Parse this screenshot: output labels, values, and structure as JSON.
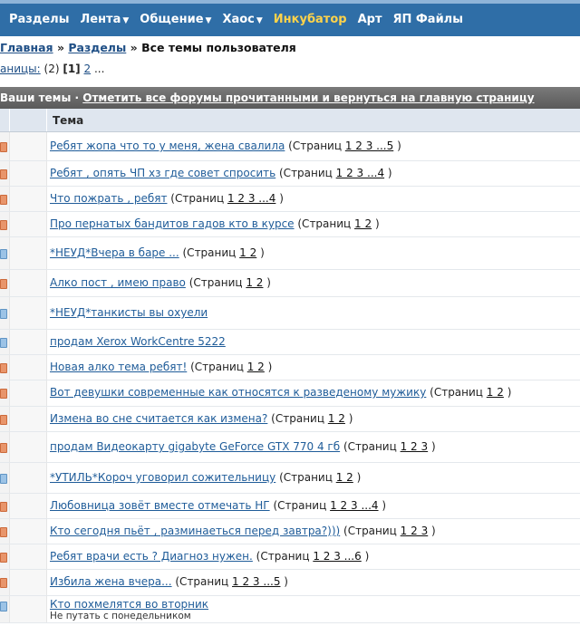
{
  "nav": [
    {
      "label": "Разделы",
      "dropdown": false,
      "highlight": false
    },
    {
      "label": "Лента",
      "dropdown": true,
      "highlight": false
    },
    {
      "label": "Общение",
      "dropdown": true,
      "highlight": false
    },
    {
      "label": "Хаос",
      "dropdown": true,
      "highlight": false
    },
    {
      "label": "Инкубатор",
      "dropdown": false,
      "highlight": true
    },
    {
      "label": "Арт",
      "dropdown": false,
      "highlight": false
    },
    {
      "label": "ЯП Файлы",
      "dropdown": false,
      "highlight": false
    }
  ],
  "breadcrumb": {
    "home": "Главная",
    "sep": "»",
    "sections": "Разделы",
    "current": "Все темы пользователя"
  },
  "pagination": {
    "prefix": "аницы:",
    "count": "(2)",
    "current": "[1]",
    "next": "2",
    "more": "..."
  },
  "section": {
    "title": "Ваши темы",
    "sep": "·",
    "link": "Отметить все форумы прочитанными и вернуться на главную страницу"
  },
  "table": {
    "header": "Тема"
  },
  "topics": [
    {
      "title": "Ребят жопа что то у меня, жена свалила",
      "pages": "1 2 3 ...5",
      "icon": "hot",
      "sub": ""
    },
    {
      "title": "Ребят , опять ЧП хз где совет спросить",
      "pages": "1 2 3 ...4",
      "icon": "hot",
      "sub": ""
    },
    {
      "title": "Что пожрать , ребят",
      "pages": "1 2 3 ...4",
      "icon": "hot",
      "sub": ""
    },
    {
      "title": "Про пернатых бандитов гадов кто в курсе",
      "pages": "1 2",
      "icon": "hot",
      "sub": ""
    },
    {
      "title": "*НЕУД*Вчера в баре ...",
      "pages": "1 2",
      "icon": "cold",
      "sub": ""
    },
    {
      "title": "Алко пост , имею право",
      "pages": "1 2",
      "icon": "hot",
      "sub": ""
    },
    {
      "title": "*НЕУД*танкисты вы охуели",
      "pages": "",
      "icon": "cold",
      "sub": ""
    },
    {
      "title": "продам Xerox WorkCentre 5222",
      "pages": "",
      "icon": "cold",
      "sub": ""
    },
    {
      "title": "Новая алко тема ребят!",
      "pages": "1 2",
      "icon": "hot",
      "sub": ""
    },
    {
      "title": "Вот девушки современные как относятся к разведеному мужику",
      "pages": "1 2",
      "icon": "hot",
      "sub": ""
    },
    {
      "title": "Измена во сне считается как измена?",
      "pages": "1 2",
      "icon": "hot",
      "sub": ""
    },
    {
      "title": "продам Видеокарту gigabyte GeForce GTX 770 4 гб",
      "pages": "1 2 3",
      "icon": "hot",
      "sub": ""
    },
    {
      "title": "*УТИЛЬ*Короч уговорил сожительницу",
      "pages": "1 2",
      "icon": "cold",
      "sub": ""
    },
    {
      "title": "Любовница зовёт вместе отмечать НГ",
      "pages": "1 2 3 ...4",
      "icon": "hot",
      "sub": ""
    },
    {
      "title": "Кто сегодня пьёт , разминаеться перед завтра?)))",
      "pages": "1 2 3",
      "icon": "hot",
      "sub": ""
    },
    {
      "title": "Ребят врачи есть ? Диагноз нужен.",
      "pages": "1 2 3 ...6",
      "icon": "hot",
      "sub": ""
    },
    {
      "title": "Избила жена вчера...",
      "pages": "1 2 3 ...5",
      "icon": "hot",
      "sub": ""
    },
    {
      "title": "Кто похмелятся во вторник",
      "pages": "",
      "icon": "cold",
      "sub": "Не путать с понедельником"
    }
  ],
  "pages_prefix": "(Страниц",
  "pages_suffix": ")"
}
